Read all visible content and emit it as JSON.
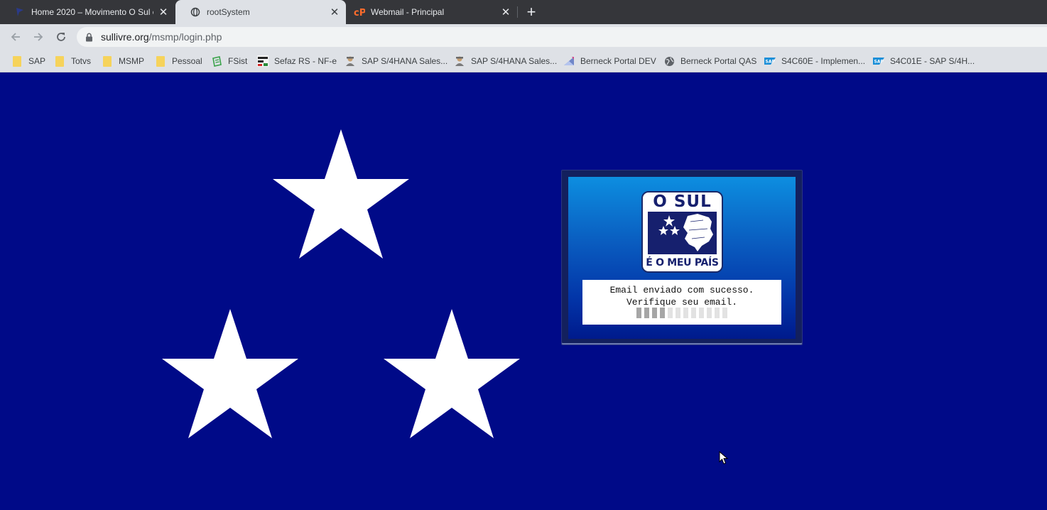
{
  "browser": {
    "tabs": [
      {
        "title": "Home 2020 – Movimento O Sul é",
        "favicon": "flag-icon",
        "active": false
      },
      {
        "title": "rootSystem",
        "favicon": "globe-icon",
        "active": true
      },
      {
        "title": "Webmail - Principal",
        "favicon": "cpanel-icon",
        "active": false
      }
    ],
    "url": {
      "host": "sullivre.org",
      "path": "/msmp/login.php"
    },
    "bookmarks": [
      {
        "label": "SAP",
        "icon": "folder-icon"
      },
      {
        "label": "Totvs",
        "icon": "folder-icon"
      },
      {
        "label": "MSMP",
        "icon": "folder-icon"
      },
      {
        "label": "Pessoal",
        "icon": "folder-icon"
      },
      {
        "label": "FSist",
        "icon": "fsist-icon"
      },
      {
        "label": "Sefaz RS - NF-e",
        "icon": "sefaz-icon"
      },
      {
        "label": "SAP S/4HANA Sales...",
        "icon": "user-icon"
      },
      {
        "label": "SAP S/4HANA Sales...",
        "icon": "user-icon"
      },
      {
        "label": "Berneck Portal DEV",
        "icon": "portal-icon"
      },
      {
        "label": "Berneck Portal QAS",
        "icon": "globe-icon"
      },
      {
        "label": "S4C60E - Implemen...",
        "icon": "sap-icon"
      },
      {
        "label": "S4C01E - SAP S/4H...",
        "icon": "sap-icon"
      }
    ]
  },
  "page": {
    "logo": {
      "top_text": "O SUL",
      "bottom_text": "É O MEU PAÍS"
    },
    "message": {
      "line1": "Email enviado com sucesso.",
      "line2": "Verifique seu email."
    },
    "progress": {
      "filled": 4,
      "total": 12
    }
  },
  "colors": {
    "background": "#000a88",
    "panel_gradient_top": "#0d8ee0",
    "panel_gradient_bottom": "#001a8c",
    "logo_navy": "#16206e",
    "star": "#ffffff"
  }
}
